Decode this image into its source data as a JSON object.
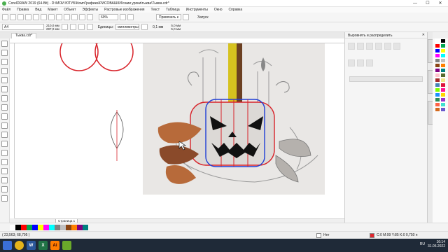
{
  "window": {
    "title": "CorelDRAW 2019 (64-Bit) - D:\\МОЙ ЮТУБ\\КомпГрафика\\РИСОВАШКИ\\сами уроки\\тыква\\Тыква.cdr*",
    "minimize": "—",
    "maximize": "☐",
    "close": "✕"
  },
  "menu": [
    "Файл",
    "Правка",
    "Вид",
    "Макет",
    "Объект",
    "Эффекты",
    "Растровые изображения",
    "Текст",
    "Таблица",
    "Инструменты",
    "Окно",
    "Справка"
  ],
  "toolbar": {
    "zoom": "69%",
    "snap": "Привязать к",
    "launch": "Запуск"
  },
  "property_bar": {
    "page_size": "A4",
    "width": "210,0 мм",
    "height": "297,0 мм",
    "units_label": "Единицы:",
    "units": "миллиметры",
    "nudge": "0,1 мм",
    "dup_x": "5,0 мм",
    "dup_y": "5,0 мм"
  },
  "document_tab": "Тыква.cdr*",
  "docker": {
    "title": "Выровнять и распределить",
    "close": "✕"
  },
  "page_tab": "Страница 1",
  "status": {
    "coords": "( 23,563; 68,795 )",
    "fill": "Нет",
    "outline": "C:0 M:99 Y:85 K:0  0,750 п"
  },
  "taskbar": {
    "apps": [
      "Word",
      "Excel",
      "Illustrator",
      "CorelDRAW"
    ],
    "lang": "RU",
    "time": "16:14",
    "date": "31.05.2022"
  },
  "colors": {
    "palette": [
      "#ffffff",
      "#000000",
      "#ff0000",
      "#00a651",
      "#0000ff",
      "#ffff00",
      "#ff00ff",
      "#00ffff",
      "#808080",
      "#c0c0c0",
      "#8b4513",
      "#ff8000",
      "#800080",
      "#008080",
      "#ffc0cb",
      "#556b2f",
      "#a52a2a",
      "#f0e68c",
      "#4682b4",
      "#dc143c",
      "#7fff00",
      "#ff1493",
      "#1e90ff",
      "#ffd700",
      "#2e8b57",
      "#9932cc",
      "#ff6347",
      "#40e0d0",
      "#d2691e",
      "#6a5acd"
    ],
    "selection_red": "#d8232a",
    "selection_blue": "#1f3fd6",
    "leaf_brown": "#8a4a2a",
    "leaf_orange": "#b76a3a",
    "candle_yellow": "#d6c21f",
    "taskbar_bg": "#1f2a38",
    "outline_swatch": "#e0252c"
  }
}
